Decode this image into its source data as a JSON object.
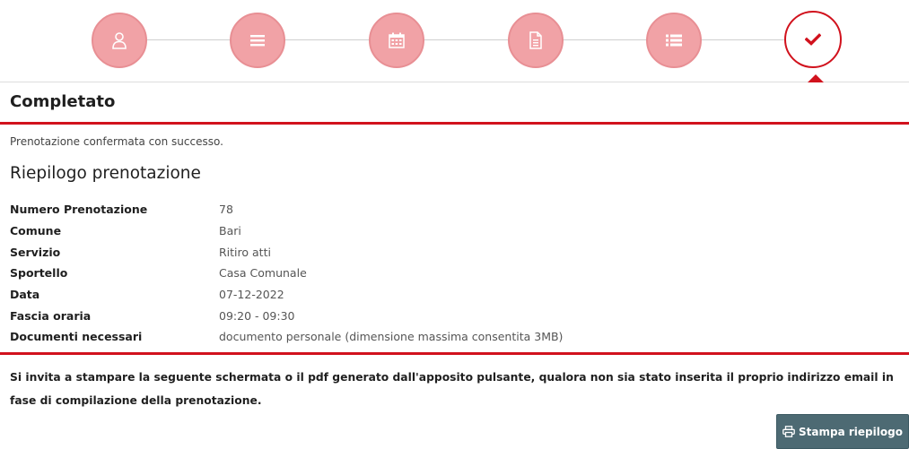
{
  "colors": {
    "accent": "#d1121d",
    "step_inactive_fill": "#f1a2a6",
    "button_bg": "#4d6a73"
  },
  "stepper": {
    "steps": [
      {
        "icon": "user-icon",
        "state": "done"
      },
      {
        "icon": "list-icon",
        "state": "done"
      },
      {
        "icon": "calendar-icon",
        "state": "done"
      },
      {
        "icon": "document-icon",
        "state": "done"
      },
      {
        "icon": "list-detail-icon",
        "state": "done"
      },
      {
        "icon": "check-icon",
        "state": "active"
      }
    ]
  },
  "completed": {
    "title": "Completato",
    "message": "Prenotazione confermata con successo."
  },
  "summary": {
    "title": "Riepilogo prenotazione",
    "rows": [
      {
        "label": "Numero Prenotazione",
        "value": "78"
      },
      {
        "label": "Comune",
        "value": "Bari"
      },
      {
        "label": "Servizio",
        "value": "Ritiro atti"
      },
      {
        "label": "Sportello",
        "value": "Casa Comunale"
      },
      {
        "label": "Data",
        "value": "07-12-2022"
      },
      {
        "label": "Fascia oraria",
        "value": "09:20 - 09:30"
      },
      {
        "label": "Documenti necessari",
        "value": "documento personale (dimensione massima consentita 3MB)"
      }
    ]
  },
  "notice": "Si invita a stampare la seguente schermata o il pdf generato dall'apposito pulsante, qualora non sia stato inserita il proprio indirizzo email in fase di compilazione della prenotazione.",
  "print_button": {
    "label": "Stampa riepilogo",
    "icon": "printer-icon"
  }
}
